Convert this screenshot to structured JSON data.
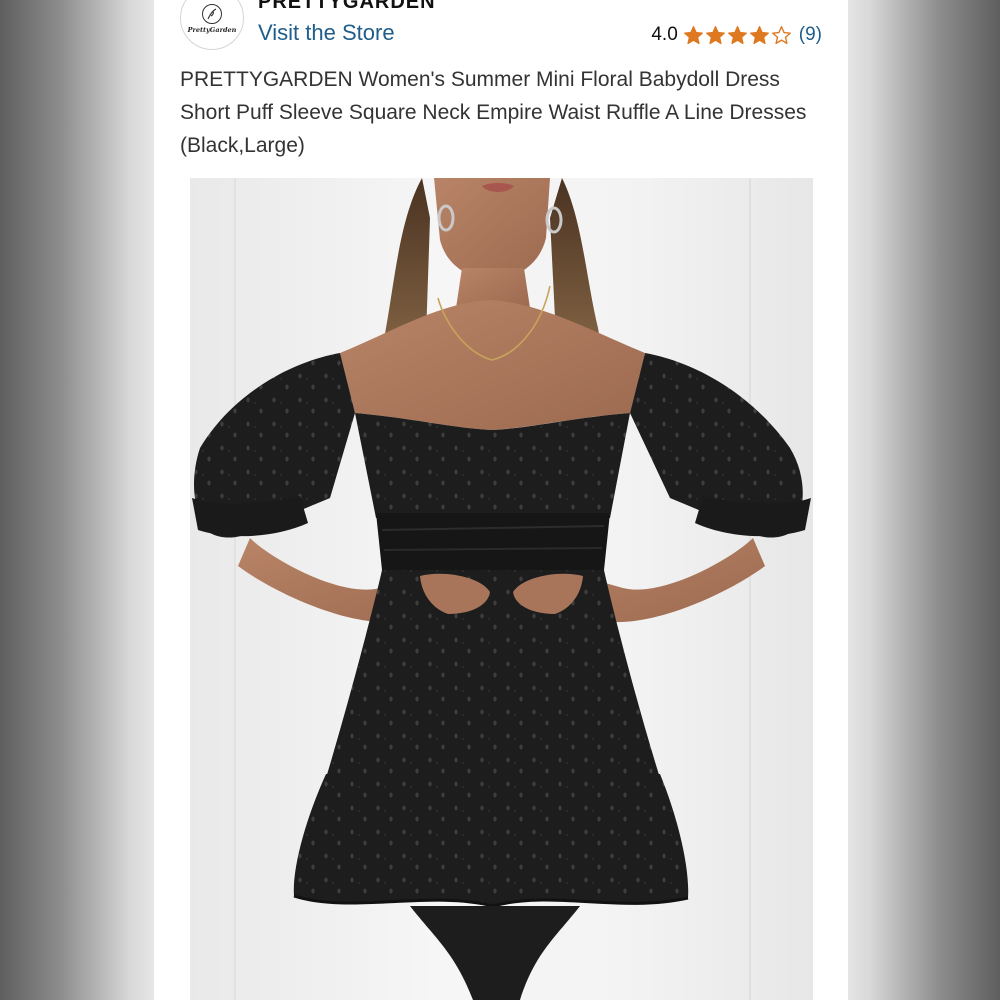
{
  "store": {
    "brand_name": "PRETTYGARDEN",
    "logo_text": "PrettyGarden",
    "visit_label": "Visit the Store"
  },
  "rating": {
    "value": "4.0",
    "stars_filled": 4,
    "stars_total": 5,
    "review_count": "(9)",
    "star_color": "#de7921"
  },
  "product": {
    "title": "PRETTYGARDEN Women's Summer Mini Floral Babydoll Dress Short Puff Sleeve Square Neck Empire Waist Ruffle A Line Dresses (Black,Large)"
  },
  "colors": {
    "link": "#1f5e8a",
    "text": "#333333"
  }
}
